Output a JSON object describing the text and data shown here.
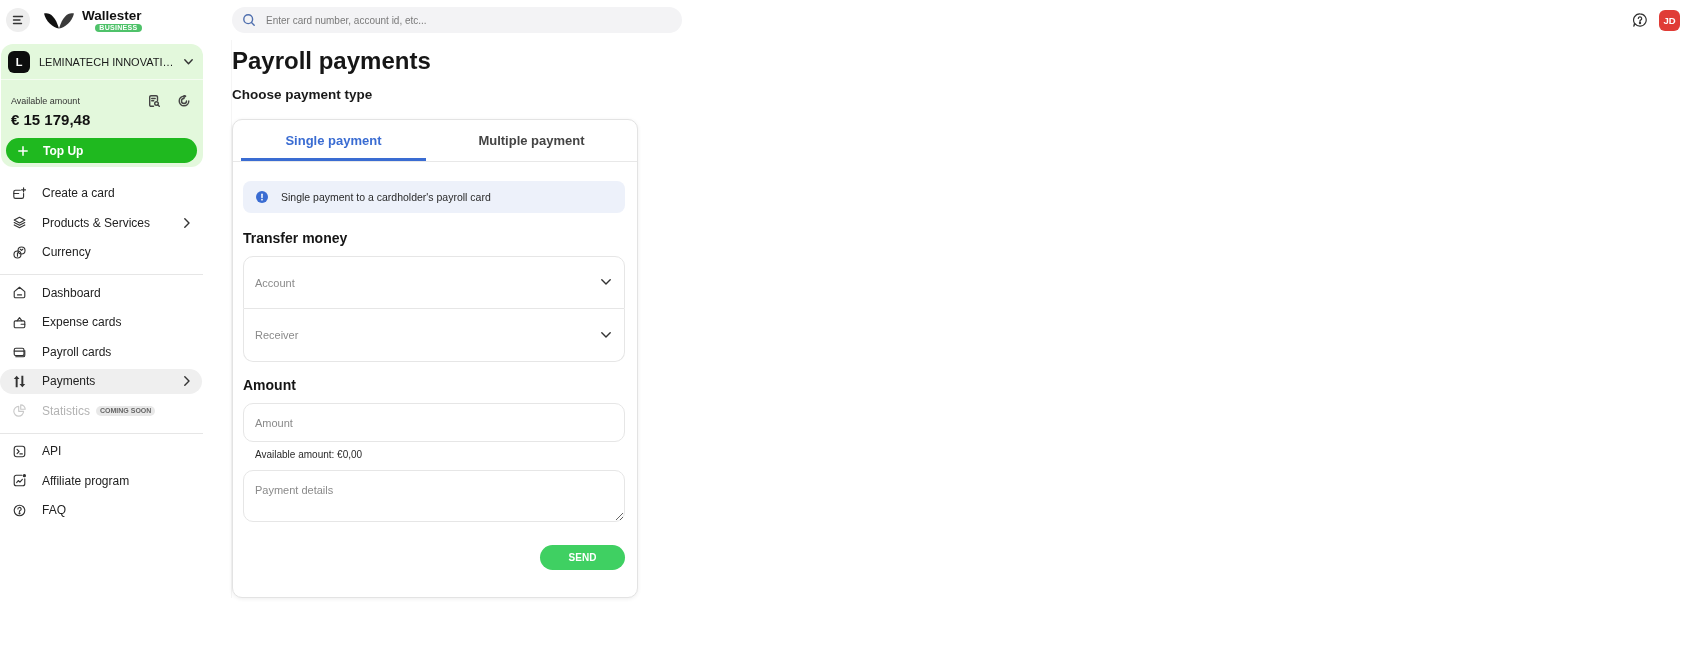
{
  "topbar": {
    "logo": {
      "wordmark": "Wallester",
      "badge": "BUSINESS"
    },
    "search": {
      "placeholder": "Enter card number, account id, etc..."
    },
    "avatar": "JD"
  },
  "account": {
    "initial": "L",
    "name": "LEMINATECH INNOVATI…",
    "balance_label": "Available amount",
    "balance": "€ 15 179,48",
    "top_up": "Top Up"
  },
  "sidebar": {
    "groups": [
      {
        "items": [
          {
            "label": "Create a card",
            "selected": false,
            "disabled": false,
            "submenu": false
          },
          {
            "label": "Products & Services",
            "selected": false,
            "disabled": false,
            "submenu": true
          },
          {
            "label": "Currency",
            "selected": false,
            "disabled": false,
            "submenu": false
          }
        ]
      },
      {
        "items": [
          {
            "label": "Dashboard",
            "selected": false,
            "disabled": false,
            "submenu": false
          },
          {
            "label": "Expense cards",
            "selected": false,
            "disabled": false,
            "submenu": false
          },
          {
            "label": "Payroll cards",
            "selected": false,
            "disabled": false,
            "submenu": false
          },
          {
            "label": "Payments",
            "selected": true,
            "disabled": false,
            "submenu": true
          },
          {
            "label": "Statistics",
            "selected": false,
            "disabled": true,
            "submenu": false,
            "badge": "COMING SOON"
          }
        ]
      },
      {
        "items": [
          {
            "label": "API",
            "selected": false,
            "disabled": false,
            "submenu": false
          },
          {
            "label": "Affiliate program",
            "selected": false,
            "disabled": false,
            "submenu": false
          },
          {
            "label": "FAQ",
            "selected": false,
            "disabled": false,
            "submenu": false
          }
        ]
      }
    ]
  },
  "main": {
    "title": "Payroll payments",
    "subtitle": "Choose payment type",
    "tabs": [
      {
        "label": "Single payment",
        "selected": true
      },
      {
        "label": "Multiple payment",
        "selected": false
      }
    ],
    "info": "Single payment to a cardholder's payroll card",
    "transfer": {
      "heading": "Transfer money",
      "selects": [
        {
          "placeholder": "Account"
        },
        {
          "placeholder": "Receiver"
        }
      ]
    },
    "amount": {
      "heading": "Amount",
      "field": {
        "placeholder": "Amount"
      },
      "hint": "Available amount: €0,00"
    },
    "details": {
      "placeholder": "Payment details"
    },
    "send": "SEND"
  }
}
